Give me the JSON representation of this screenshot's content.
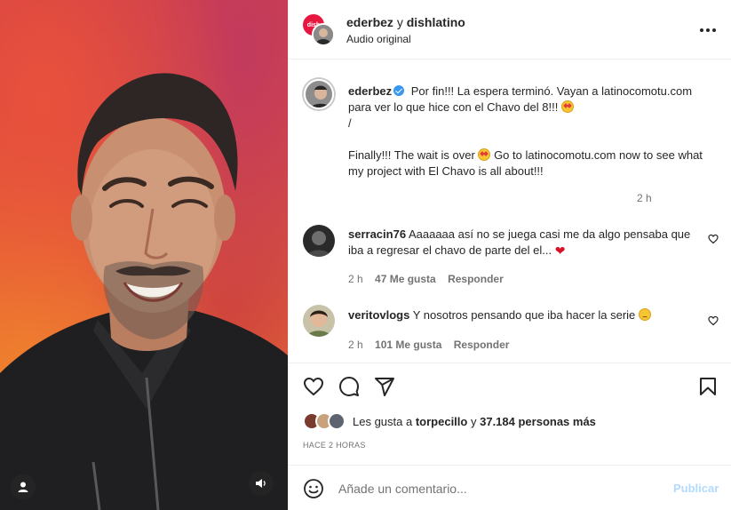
{
  "header": {
    "author": "ederbez",
    "conjunction": "y",
    "coauthor": "dishlatino",
    "audio": "Audio original",
    "dish_logo_text": "dish",
    "more_icon": "more-horizontal-icon"
  },
  "caption": {
    "username": "ederbez",
    "line1": "Por fin!!! La espera terminó. Vayan a latinocomotu.com para ver lo que hice con el Chavo del 8!!!",
    "separator": "/",
    "line2a": "Finally!!! The wait is over",
    "line2b": "Go to latinocomotu.com now to see what my project with El Chavo is all about!!!",
    "time": "2 h"
  },
  "comments": [
    {
      "username": "serracin76",
      "text": "Aaaaaaa así no se juega casi me da algo pensaba que iba a regresar el chavo de parte del el...",
      "time": "2 h",
      "likes": "47 Me gusta",
      "reply": "Responder"
    },
    {
      "username": "veritovlogs",
      "text": "Y nosotros pensando que iba hacer la serie",
      "time": "2 h",
      "likes": "101 Me gusta",
      "reply": "Responder"
    }
  ],
  "likes": {
    "prefix": "Les gusta a",
    "user": "torpecillo",
    "middle": "y",
    "count": "37.184 personas más"
  },
  "timestamp": "HACE 2 HORAS",
  "add_comment": {
    "placeholder": "Añade un comentario...",
    "publish": "Publicar"
  },
  "colors": {
    "verified": "#3897f0",
    "publish_disabled": "#b3dbff",
    "heart": "#d6112a"
  }
}
